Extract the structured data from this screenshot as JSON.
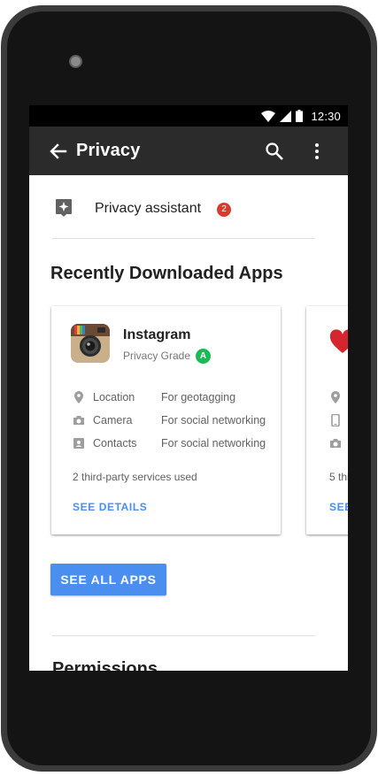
{
  "statusbar": {
    "time": "12:30",
    "icons": [
      "wifi-icon",
      "signal-icon",
      "battery-icon"
    ]
  },
  "appbar": {
    "title": "Privacy",
    "icons": [
      "back-arrow-icon",
      "search-icon",
      "more-vert-icon"
    ]
  },
  "privacy_assistant": {
    "label": "Privacy assistant",
    "badge": "2",
    "icon": "assistant-icon"
  },
  "recent": {
    "title": "Recently Downloaded Apps",
    "apps": [
      {
        "name": "Instagram",
        "grade_label": "Privacy Grade",
        "grade": "A",
        "permissions": [
          {
            "name": "Location",
            "purpose": "For geotagging",
            "icon": "location-icon"
          },
          {
            "name": "Camera",
            "purpose": "For social networking",
            "icon": "camera-icon"
          },
          {
            "name": "Contacts",
            "purpose": "For social networking",
            "icon": "contacts-icon"
          }
        ],
        "services": "2 third-party services used",
        "details": "SEE DETAILS"
      },
      {
        "permissions_icons": [
          "location-icon",
          "phone-icon",
          "camera-icon"
        ],
        "services_partial": "5 thi",
        "details_partial": "SEE"
      }
    ]
  },
  "see_all": "SEE ALL APPS",
  "next_section_partial": "Permissions",
  "colors": {
    "accent": "#4a8ef0",
    "badge_red": "#d93c2e",
    "grade_green": "#1db954",
    "toolbar": "#2b2b2b"
  }
}
